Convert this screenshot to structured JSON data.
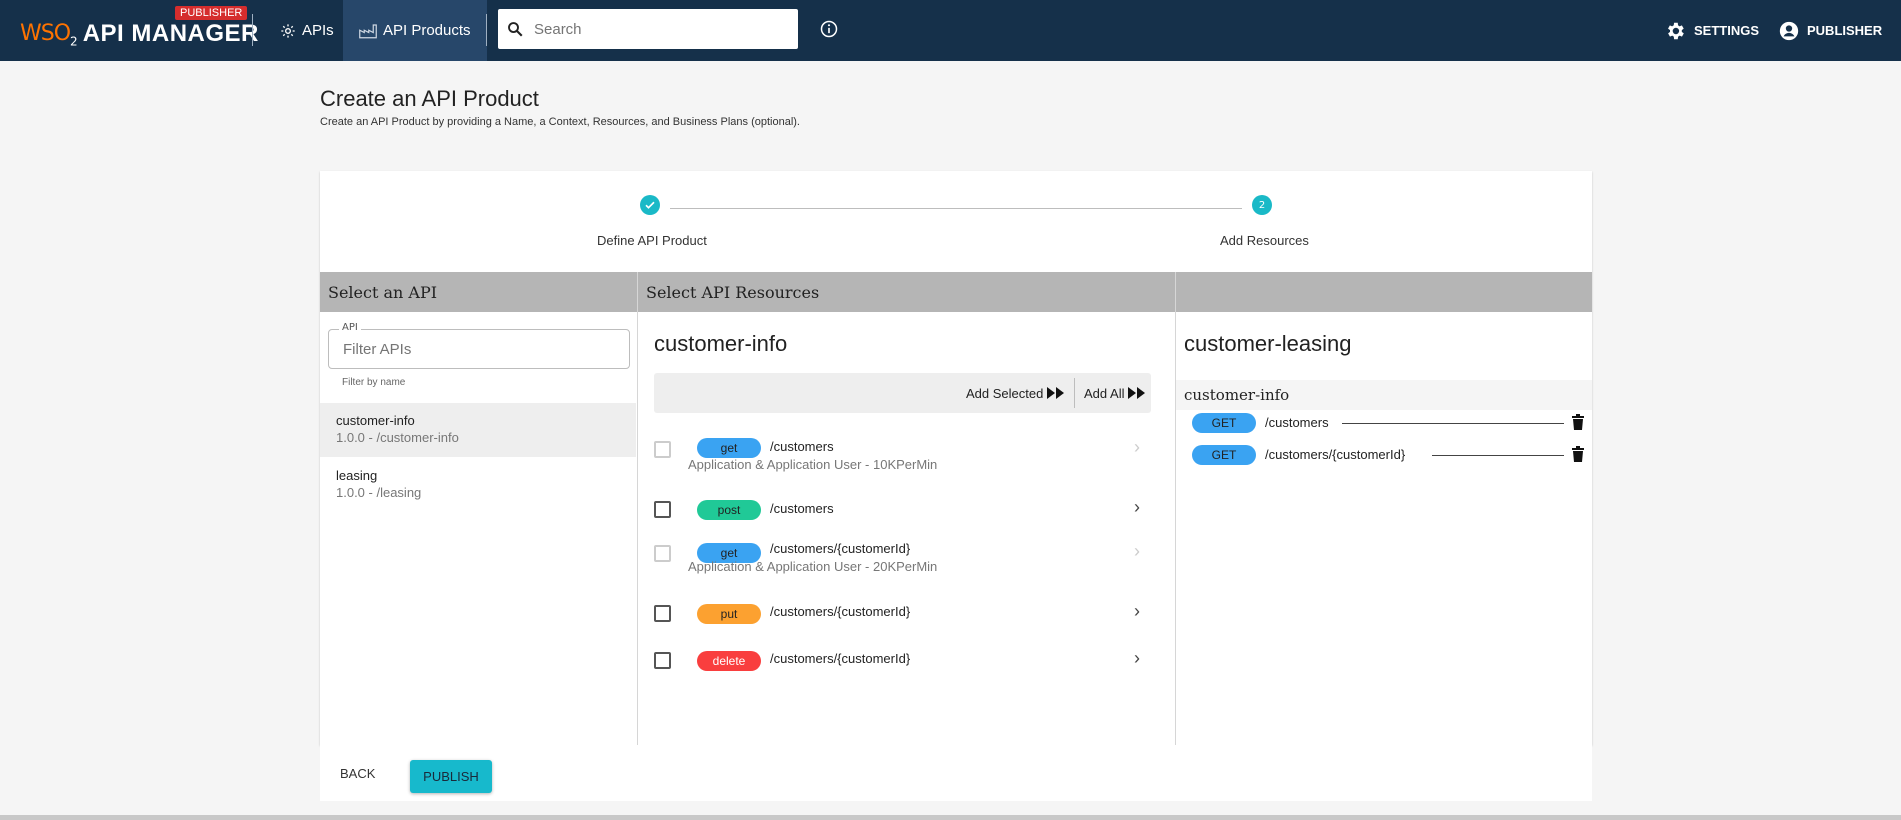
{
  "header": {
    "logo_brand": "WSO",
    "logo_sub": "2",
    "logo_product": "API MANAGER",
    "logo_badge": "PUBLISHER",
    "nav": [
      {
        "label": "APIs"
      },
      {
        "label": "API Products"
      }
    ],
    "search_placeholder": "Search",
    "settings_label": "SETTINGS",
    "user_label": "PUBLISHER",
    "colors": {
      "bar": "#15304a",
      "active_tab": "#27476a",
      "accent": "#1ab9c7"
    }
  },
  "page": {
    "title": "Create an API Product",
    "subtitle": "Create an API Product by providing a Name, a Context, Resources, and Business Plans (optional)."
  },
  "stepper": {
    "steps": [
      {
        "label": "Define API Product",
        "state": "completed",
        "icon": "check-icon"
      },
      {
        "label": "Add Resources",
        "state": "active",
        "number": "2"
      }
    ]
  },
  "columns": {
    "select_api": "Select an API",
    "select_resources": "Select API Resources"
  },
  "api_filter": {
    "label": "API",
    "placeholder": "Filter APIs",
    "helper": "Filter by name"
  },
  "apis": [
    {
      "name": "customer-info",
      "meta": "1.0.0 - /customer-info",
      "selected": true
    },
    {
      "name": "leasing",
      "meta": "1.0.0 - /leasing",
      "selected": false
    }
  ],
  "resources_panel": {
    "title": "customer-info",
    "add_selected": "Add Selected",
    "add_all": "Add All",
    "resources": [
      {
        "method": "get",
        "path": "/customers",
        "throttle": "Application & Application User - 10KPerMin",
        "disabled": true,
        "color": "#3aa3f2"
      },
      {
        "method": "post",
        "path": "/customers",
        "throttle": "",
        "disabled": false,
        "color": "#20c997"
      },
      {
        "method": "get",
        "path": "/customers/{customerId}",
        "throttle": "Application & Application User - 20KPerMin",
        "disabled": true,
        "color": "#3aa3f2"
      },
      {
        "method": "put",
        "path": "/customers/{customerId}",
        "throttle": "",
        "disabled": false,
        "color": "#fca130"
      },
      {
        "method": "delete",
        "path": "/customers/{customerId}",
        "throttle": "",
        "disabled": false,
        "color": "#f93e3e"
      }
    ]
  },
  "product_panel": {
    "title": "customer-leasing",
    "group": "customer-info",
    "selected": [
      {
        "method": "GET",
        "path": "/customers"
      },
      {
        "method": "GET",
        "path": "/customers/{customerId}"
      }
    ]
  },
  "footer": {
    "back_label": "BACK",
    "publish_label": "PUBLISH"
  }
}
